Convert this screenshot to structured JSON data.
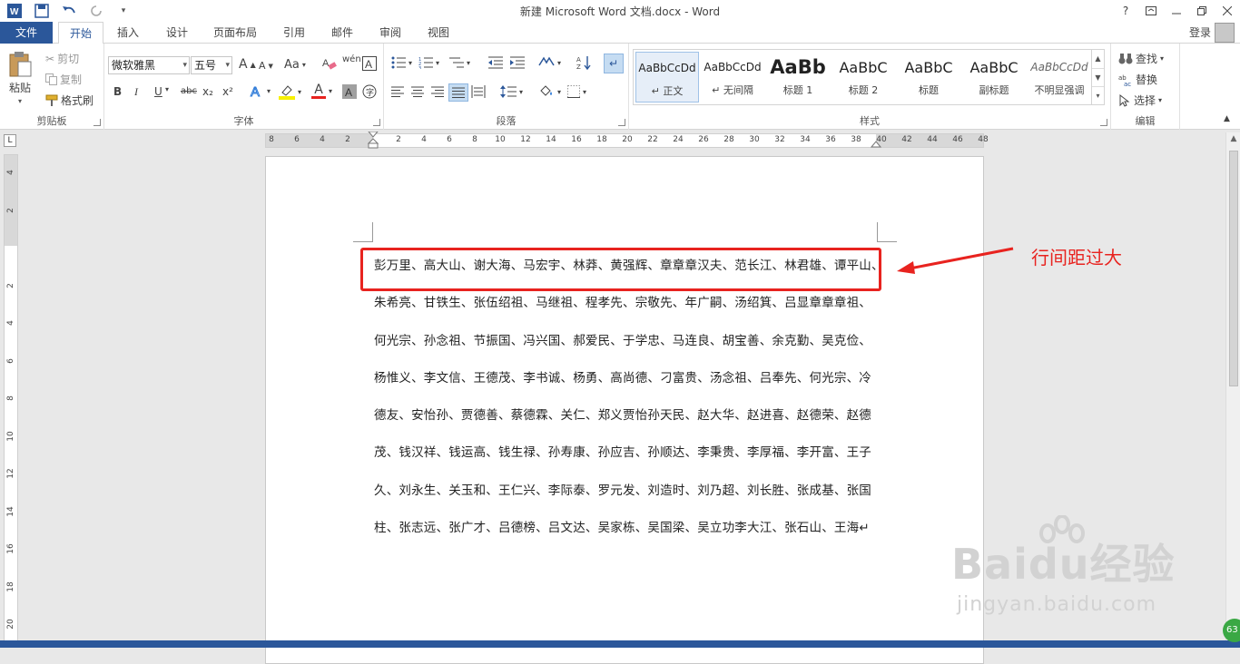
{
  "window": {
    "title": "新建 Microsoft Word 文档.docx - Word",
    "help": "?",
    "qat": [
      "word-logo-icon",
      "save-icon",
      "undo-icon",
      "redo-icon",
      "customize-icon"
    ]
  },
  "tabs": {
    "file": "文件",
    "items": [
      "开始",
      "插入",
      "设计",
      "页面布局",
      "引用",
      "邮件",
      "审阅",
      "视图"
    ],
    "active": "开始",
    "login": "登录"
  },
  "ribbon": {
    "clipboard": {
      "label": "剪贴板",
      "paste": "粘贴",
      "cut": "剪切",
      "copy": "复制",
      "format_painter": "格式刷"
    },
    "font": {
      "label": "字体",
      "font_name": "微软雅黑",
      "font_size": "五号",
      "grow": "A",
      "shrink": "A",
      "change_case": "Aa",
      "bold": "B",
      "italic": "I",
      "underline": "U",
      "strike": "abc",
      "subscript": "x₂",
      "superscript": "x²",
      "font_color_letter": "A"
    },
    "paragraph": {
      "label": "段落"
    },
    "styles": {
      "label": "样式",
      "items": [
        {
          "sample": "AaBbCcDd",
          "name": "↵ 正文"
        },
        {
          "sample": "AaBbCcDd",
          "name": "↵ 无间隔"
        },
        {
          "sample": "AaBb",
          "name": "标题 1"
        },
        {
          "sample": "AaBbC",
          "name": "标题 2"
        },
        {
          "sample": "AaBbC",
          "name": "标题"
        },
        {
          "sample": "AaBbC",
          "name": "副标题"
        },
        {
          "sample": "AaBbCcDd",
          "name": "不明显强调"
        }
      ]
    },
    "editing": {
      "label": "编辑",
      "find": "查找",
      "replace": "替换",
      "select": "选择"
    }
  },
  "ruler": {
    "h_ticks": [
      "8",
      "6",
      "4",
      "2",
      "2",
      "4",
      "6",
      "8",
      "10",
      "12",
      "14",
      "16",
      "18",
      "20",
      "22",
      "24",
      "26",
      "28",
      "30",
      "32",
      "34",
      "36",
      "38",
      "40",
      "42",
      "44",
      "46",
      "48"
    ],
    "v_ticks": [
      "4",
      "2",
      "2",
      "4",
      "6",
      "8",
      "10",
      "12",
      "14",
      "16",
      "18",
      "20"
    ],
    "corner": "L"
  },
  "document": {
    "lines": [
      "彭万里、高大山、谢大海、马宏宇、林莽、黄强辉、章章章汉夫、范长江、林君雄、谭平山、",
      "朱希亮、甘铁生、张伍绍祖、马继祖、程孝先、宗敬先、年广嗣、汤绍箕、吕显章章章祖、",
      "何光宗、孙念祖、节振国、冯兴国、郝爱民、于学忠、马连良、胡宝善、余克勤、吴克俭、",
      "杨惟义、李文信、王德茂、李书诚、杨勇、高尚德、刁富贵、汤念祖、吕奉先、何光宗、冷",
      "德友、安怡孙、贾德善、蔡德霖、关仁、郑义贾怡孙天民、赵大华、赵进喜、赵德荣、赵德",
      "茂、钱汉祥、钱运高、钱生禄、孙寿康、孙应吉、孙顺达、李秉贵、李厚福、李开富、王子",
      "久、刘永生、关玉和、王仁兴、李际泰、罗元发、刘造时、刘乃超、刘长胜、张成基、张国",
      "柱、张志远、张广才、吕德榜、吕文达、吴家栋、吴国梁、吴立功李大江、张石山、王海↵"
    ]
  },
  "annotation": {
    "text": "行间距过大",
    "color": "#e8231f"
  },
  "watermark": {
    "brand": "Baidu经验",
    "url": "jingyan.baidu.com"
  },
  "badge": "63",
  "colors": {
    "accent": "#2b579a",
    "annotation": "#e8231f"
  }
}
